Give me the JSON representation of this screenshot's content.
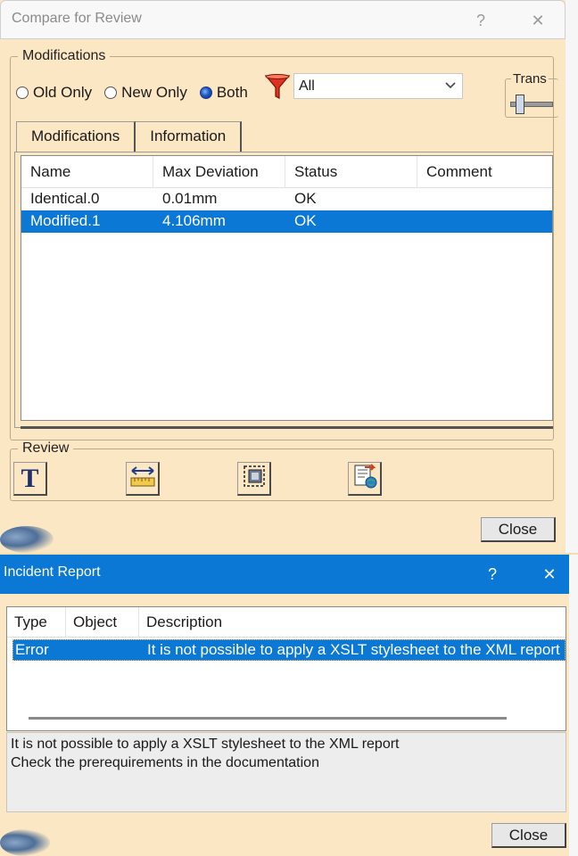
{
  "compare_dialog": {
    "title": "Compare for Review",
    "help_glyph": "?",
    "close_glyph": "✕",
    "modifications_group": "Modifications",
    "radios": [
      {
        "label": "Old Only",
        "selected": false
      },
      {
        "label": "New Only",
        "selected": false
      },
      {
        "label": "Both",
        "selected": true
      }
    ],
    "filter_value": "All",
    "trans_label": "Trans",
    "tabs": [
      {
        "label": "Modifications",
        "active": true
      },
      {
        "label": "Information",
        "active": false
      }
    ],
    "columns": [
      "Name",
      "Max Deviation",
      "Status",
      "Comment"
    ],
    "rows": [
      {
        "name": "Identical.0",
        "deviation": "0.01mm",
        "status": "OK",
        "comment": "",
        "selected": false
      },
      {
        "name": "Modified.1",
        "deviation": "4.106mm",
        "status": "OK",
        "comment": "",
        "selected": true
      }
    ],
    "review_group": "Review",
    "review_tools": [
      "text-annotation-icon",
      "measure-icon",
      "capture-icon",
      "report-icon"
    ],
    "review_text_glyph": "T",
    "close_label": "Close"
  },
  "incident_dialog": {
    "title": "Incident Report",
    "help_glyph": "?",
    "close_glyph": "✕",
    "columns": [
      "Type",
      "Object",
      "Description"
    ],
    "rows": [
      {
        "type": "Error",
        "object": "",
        "description": "It is not possible to apply a XSLT stylesheet to the XML report",
        "selected": true
      }
    ],
    "message_lines": [
      "It is not possible to apply a XSLT stylesheet to the XML report",
      "Check the prerequirements in the documentation"
    ],
    "close_label": "Close"
  },
  "colors": {
    "panel": "#fbe7c4",
    "selection": "#0b78d6",
    "incident_titlebar": "#0b78d6"
  }
}
